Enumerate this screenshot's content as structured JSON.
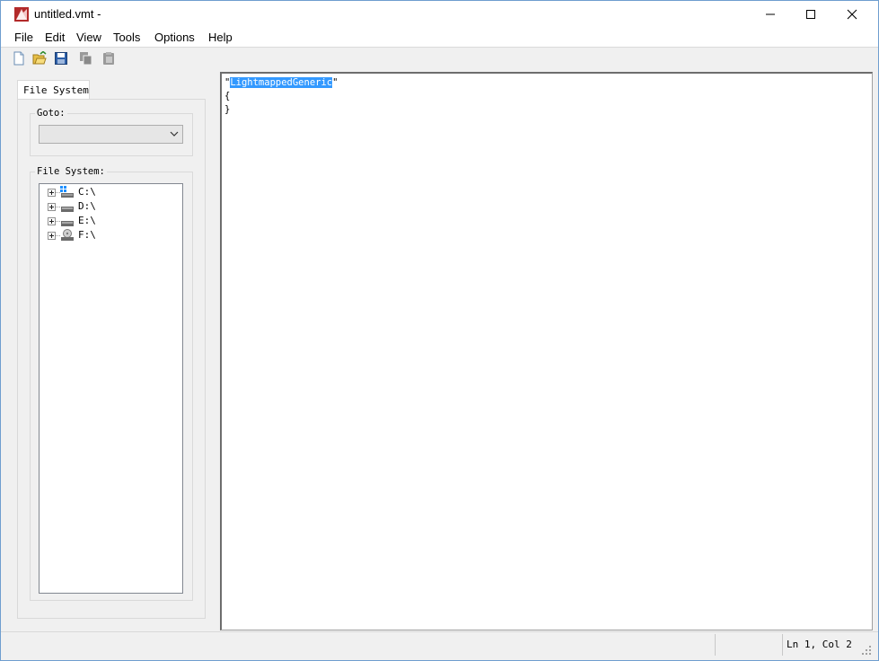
{
  "window": {
    "title": "untitled.vmt -"
  },
  "menu": [
    "File",
    "Edit",
    "View",
    "Tools",
    "Options",
    "Help"
  ],
  "toolbar": {
    "icons": [
      "new-file-icon",
      "open-folder-icon",
      "save-icon",
      "copy-icon",
      "paste-icon"
    ]
  },
  "left_panel": {
    "tab_label": "File System",
    "goto_label": "Goto:",
    "goto_value": "",
    "filesystem_label": "File System:",
    "drives": [
      {
        "label": "C:\\",
        "icon": "windows-drive-icon"
      },
      {
        "label": "D:\\",
        "icon": "hard-drive-icon"
      },
      {
        "label": "E:\\",
        "icon": "hard-drive-icon"
      },
      {
        "label": "F:\\",
        "icon": "optical-drive-icon"
      }
    ]
  },
  "editor": {
    "line1_prefix": "\"",
    "line1_selected": "LightmappedGeneric",
    "line1_suffix": "\"",
    "line2": "{",
    "line3": "}"
  },
  "status": {
    "position": "Ln 1, Col 2"
  },
  "colors": {
    "selection": "#3399ff",
    "accent": "#0078d7"
  }
}
